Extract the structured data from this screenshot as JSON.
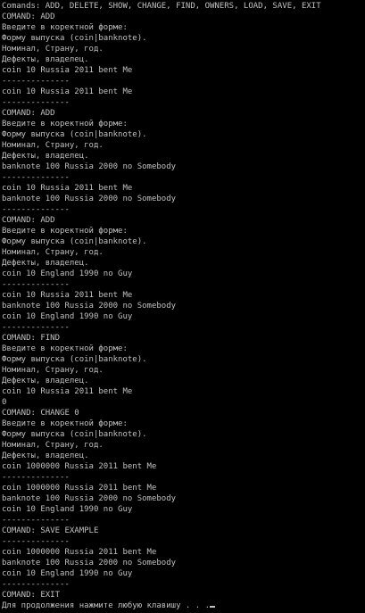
{
  "colors": {
    "background": "#000000",
    "text": "#c0c0c0"
  },
  "console": {
    "lines": [
      "Comands: ADD, DELETE, SHOW, CHANGE, FIND, OWNERS, LOAD, SAVE, EXIT",
      "COMAND: ADD",
      "Введите в коректной форме:",
      "Форму выпуска (coin|banknote).",
      "Номинал, Страну, год.",
      "Дефекты, владелец.",
      "coin 10 Russia 2011 bent Me",
      "--------------",
      "coin 10 Russia 2011 bent Me",
      "--------------",
      "COMAND: ADD",
      "Введите в коректной форме:",
      "Форму выпуска (coin|banknote).",
      "Номинал, Страну, год.",
      "Дефекты, владелец.",
      "banknote 100 Russia 2000 no Somebody",
      "--------------",
      "coin 10 Russia 2011 bent Me",
      "banknote 100 Russia 2000 no Somebody",
      "--------------",
      "COMAND: ADD",
      "Введите в коректной форме:",
      "Форму выпуска (coin|banknote).",
      "Номинал, Страну, год.",
      "Дефекты, владелец.",
      "coin 10 England 1990 no Guy",
      "--------------",
      "coin 10 Russia 2011 bent Me",
      "banknote 100 Russia 2000 no Somebody",
      "coin 10 England 1990 no Guy",
      "--------------",
      "COMAND: FIND",
      "Введите в коректной форме:",
      "Форму выпуска (coin|banknote).",
      "Номинал, Страну, год.",
      "Дефекты, владелец.",
      "coin 10 Russia 2011 bent Me",
      "0",
      "COMAND: CHANGE 0",
      "Введите в коректной форме:",
      "Форму выпуска (coin|banknote).",
      "Номинал, Страну, год.",
      "Дефекты, владелец.",
      "coin 1000000 Russia 2011 bent Me",
      "--------------",
      "coin 1000000 Russia 2011 bent Me",
      "banknote 100 Russia 2000 no Somebody",
      "coin 10 England 1990 no Guy",
      "--------------",
      "COMAND: SAVE EXAMPLE",
      "--------------",
      "coin 1000000 Russia 2011 bent Me",
      "banknote 100 Russia 2000 no Somebody",
      "coin 10 England 1990 no Guy",
      "--------------",
      "COMAND: EXIT",
      "Для продолжения нажмите любую клавишу . . ."
    ]
  }
}
